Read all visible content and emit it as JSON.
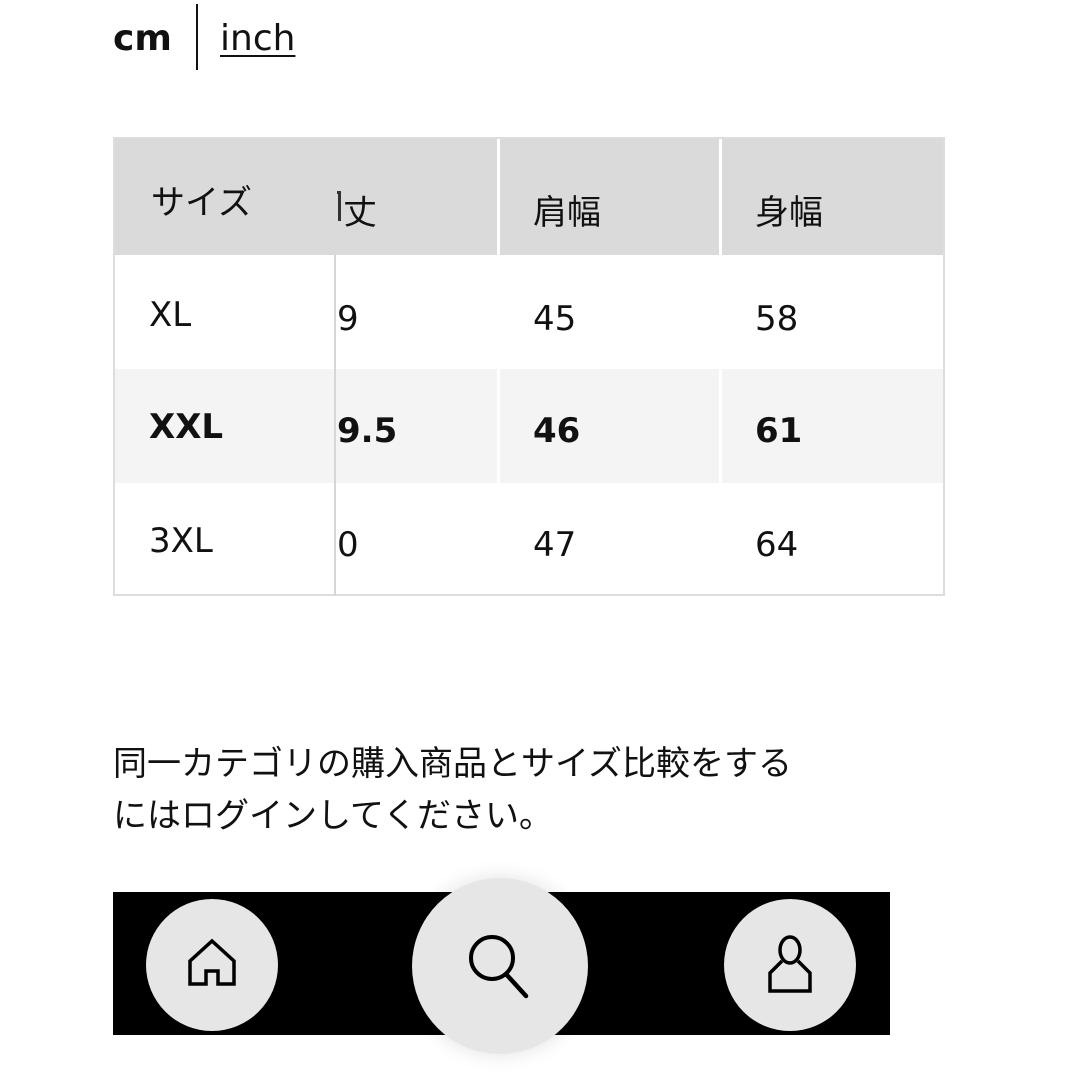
{
  "units": {
    "cm": "cm",
    "inch": "inch",
    "selected": "cm"
  },
  "table": {
    "headers": [
      "サイズ",
      "丈",
      "肩幅",
      "身幅"
    ],
    "rows": [
      {
        "size": "XL",
        "c1": "9",
        "c2": "45",
        "c3": "58",
        "highlight": false
      },
      {
        "size": "XXL",
        "c1": "9.5",
        "c2": "46",
        "c3": "61",
        "highlight": true
      },
      {
        "size": "3XL",
        "c1": "0",
        "c2": "47",
        "c3": "64",
        "highlight": false
      }
    ]
  },
  "note": {
    "line1": "同一カテゴリの購入商品とサイズ比較をする",
    "line2": "にはログインしてください。"
  },
  "nav": {
    "items": [
      {
        "icon": "home-icon"
      },
      {
        "icon": "search-icon"
      },
      {
        "icon": "user-icon"
      }
    ]
  }
}
